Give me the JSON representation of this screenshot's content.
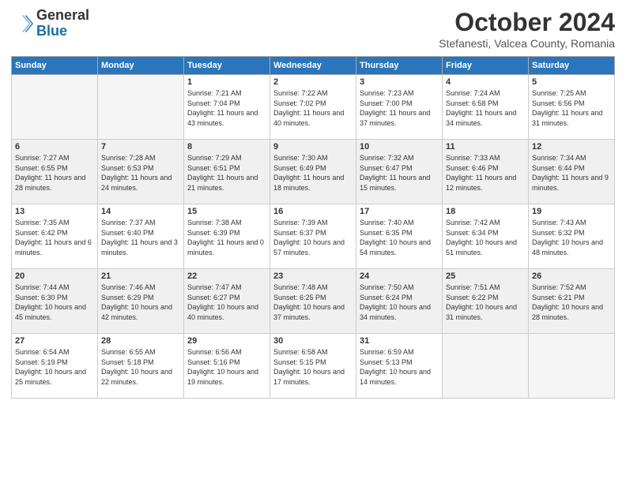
{
  "header": {
    "logo": {
      "general": "General",
      "blue": "Blue"
    },
    "title": "October 2024",
    "location": "Stefanesti, Valcea County, Romania"
  },
  "days_of_week": [
    "Sunday",
    "Monday",
    "Tuesday",
    "Wednesday",
    "Thursday",
    "Friday",
    "Saturday"
  ],
  "weeks": [
    [
      {
        "day": "",
        "info": ""
      },
      {
        "day": "",
        "info": ""
      },
      {
        "day": "1",
        "info": "Sunrise: 7:21 AM\nSunset: 7:04 PM\nDaylight: 11 hours and 43 minutes."
      },
      {
        "day": "2",
        "info": "Sunrise: 7:22 AM\nSunset: 7:02 PM\nDaylight: 11 hours and 40 minutes."
      },
      {
        "day": "3",
        "info": "Sunrise: 7:23 AM\nSunset: 7:00 PM\nDaylight: 11 hours and 37 minutes."
      },
      {
        "day": "4",
        "info": "Sunrise: 7:24 AM\nSunset: 6:58 PM\nDaylight: 11 hours and 34 minutes."
      },
      {
        "day": "5",
        "info": "Sunrise: 7:25 AM\nSunset: 6:56 PM\nDaylight: 11 hours and 31 minutes."
      }
    ],
    [
      {
        "day": "6",
        "info": "Sunrise: 7:27 AM\nSunset: 6:55 PM\nDaylight: 11 hours and 28 minutes."
      },
      {
        "day": "7",
        "info": "Sunrise: 7:28 AM\nSunset: 6:53 PM\nDaylight: 11 hours and 24 minutes."
      },
      {
        "day": "8",
        "info": "Sunrise: 7:29 AM\nSunset: 6:51 PM\nDaylight: 11 hours and 21 minutes."
      },
      {
        "day": "9",
        "info": "Sunrise: 7:30 AM\nSunset: 6:49 PM\nDaylight: 11 hours and 18 minutes."
      },
      {
        "day": "10",
        "info": "Sunrise: 7:32 AM\nSunset: 6:47 PM\nDaylight: 11 hours and 15 minutes."
      },
      {
        "day": "11",
        "info": "Sunrise: 7:33 AM\nSunset: 6:46 PM\nDaylight: 11 hours and 12 minutes."
      },
      {
        "day": "12",
        "info": "Sunrise: 7:34 AM\nSunset: 6:44 PM\nDaylight: 11 hours and 9 minutes."
      }
    ],
    [
      {
        "day": "13",
        "info": "Sunrise: 7:35 AM\nSunset: 6:42 PM\nDaylight: 11 hours and 6 minutes."
      },
      {
        "day": "14",
        "info": "Sunrise: 7:37 AM\nSunset: 6:40 PM\nDaylight: 11 hours and 3 minutes."
      },
      {
        "day": "15",
        "info": "Sunrise: 7:38 AM\nSunset: 6:39 PM\nDaylight: 11 hours and 0 minutes."
      },
      {
        "day": "16",
        "info": "Sunrise: 7:39 AM\nSunset: 6:37 PM\nDaylight: 10 hours and 57 minutes."
      },
      {
        "day": "17",
        "info": "Sunrise: 7:40 AM\nSunset: 6:35 PM\nDaylight: 10 hours and 54 minutes."
      },
      {
        "day": "18",
        "info": "Sunrise: 7:42 AM\nSunset: 6:34 PM\nDaylight: 10 hours and 51 minutes."
      },
      {
        "day": "19",
        "info": "Sunrise: 7:43 AM\nSunset: 6:32 PM\nDaylight: 10 hours and 48 minutes."
      }
    ],
    [
      {
        "day": "20",
        "info": "Sunrise: 7:44 AM\nSunset: 6:30 PM\nDaylight: 10 hours and 45 minutes."
      },
      {
        "day": "21",
        "info": "Sunrise: 7:46 AM\nSunset: 6:29 PM\nDaylight: 10 hours and 42 minutes."
      },
      {
        "day": "22",
        "info": "Sunrise: 7:47 AM\nSunset: 6:27 PM\nDaylight: 10 hours and 40 minutes."
      },
      {
        "day": "23",
        "info": "Sunrise: 7:48 AM\nSunset: 6:25 PM\nDaylight: 10 hours and 37 minutes."
      },
      {
        "day": "24",
        "info": "Sunrise: 7:50 AM\nSunset: 6:24 PM\nDaylight: 10 hours and 34 minutes."
      },
      {
        "day": "25",
        "info": "Sunrise: 7:51 AM\nSunset: 6:22 PM\nDaylight: 10 hours and 31 minutes."
      },
      {
        "day": "26",
        "info": "Sunrise: 7:52 AM\nSunset: 6:21 PM\nDaylight: 10 hours and 28 minutes."
      }
    ],
    [
      {
        "day": "27",
        "info": "Sunrise: 6:54 AM\nSunset: 5:19 PM\nDaylight: 10 hours and 25 minutes."
      },
      {
        "day": "28",
        "info": "Sunrise: 6:55 AM\nSunset: 5:18 PM\nDaylight: 10 hours and 22 minutes."
      },
      {
        "day": "29",
        "info": "Sunrise: 6:56 AM\nSunset: 5:16 PM\nDaylight: 10 hours and 19 minutes."
      },
      {
        "day": "30",
        "info": "Sunrise: 6:58 AM\nSunset: 5:15 PM\nDaylight: 10 hours and 17 minutes."
      },
      {
        "day": "31",
        "info": "Sunrise: 6:59 AM\nSunset: 5:13 PM\nDaylight: 10 hours and 14 minutes."
      },
      {
        "day": "",
        "info": ""
      },
      {
        "day": "",
        "info": ""
      }
    ]
  ]
}
